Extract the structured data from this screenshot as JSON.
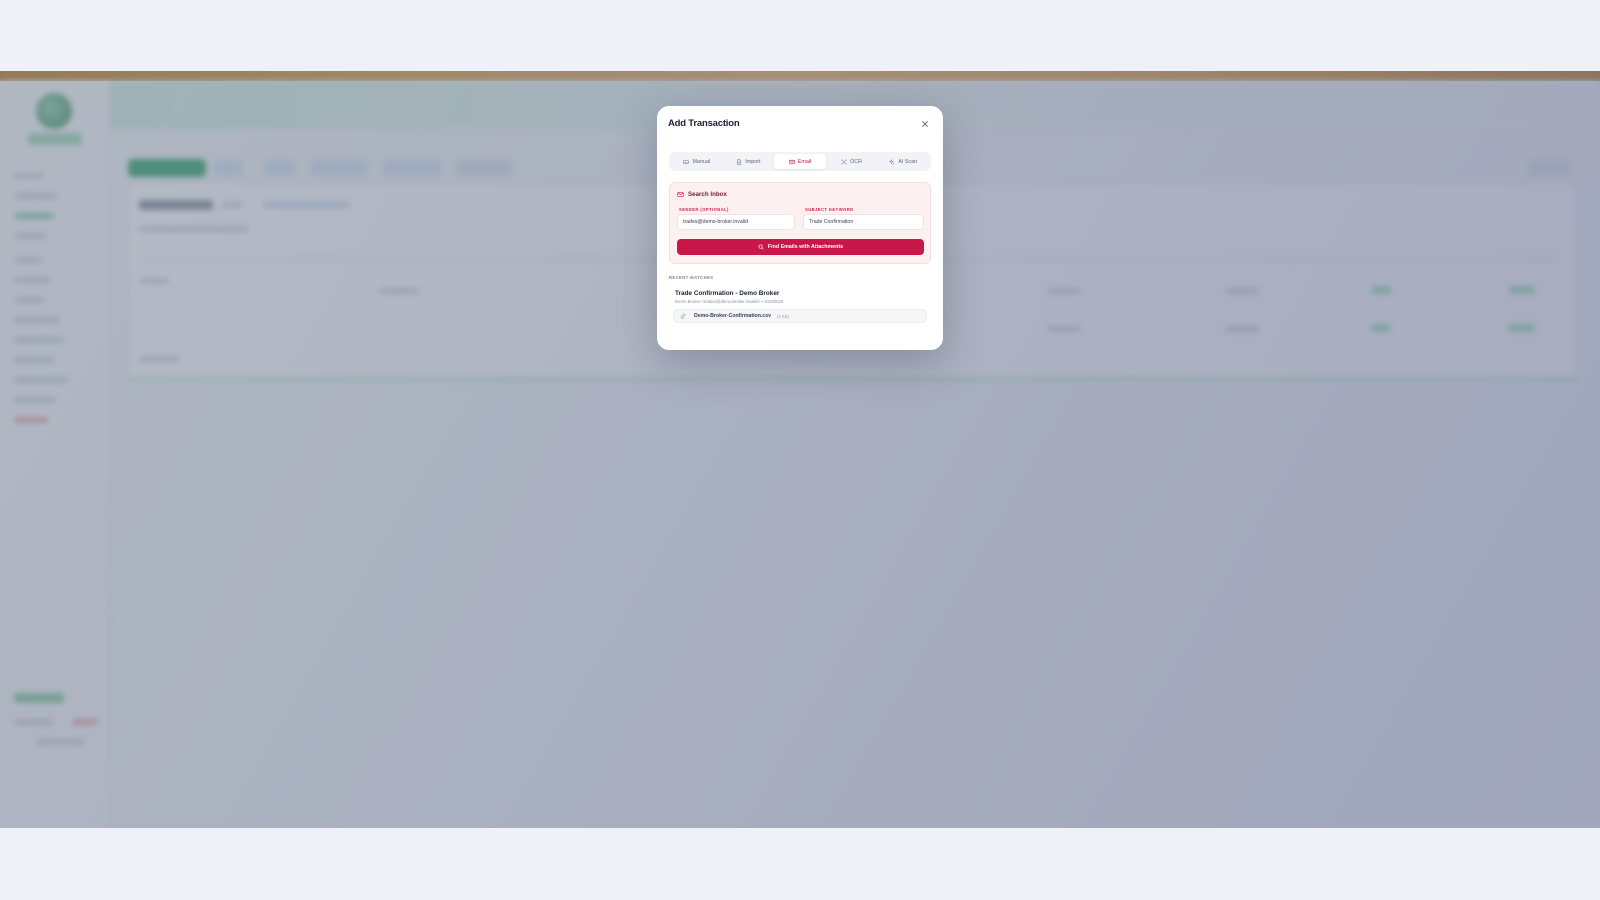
{
  "modal": {
    "title": "Add Transaction",
    "close_icon": "close-icon",
    "tabs": [
      {
        "label": "Manual",
        "icon": "keyboard-icon",
        "active": false
      },
      {
        "label": "Import",
        "icon": "document-icon",
        "active": false
      },
      {
        "label": "Email",
        "icon": "mail-icon",
        "active": true
      },
      {
        "label": "OCR",
        "icon": "scan-icon",
        "active": false
      },
      {
        "label": "AI Scan",
        "icon": "sparkle-icon",
        "active": false
      }
    ],
    "search": {
      "title": "Search Inbox",
      "sender_label": "SENDER (OPTIONAL)",
      "sender_value": "trades@demo-broker.invalid",
      "subject_label": "SUBJECT KEYWORD",
      "subject_value": "Trade Confirmation",
      "button_label": "Find Emails with Attachments"
    },
    "recent_matches_label": "RECENT MATCHES",
    "match": {
      "title": "Trade Confirmation - Demo Broker",
      "meta": "Demo Broker <trades@demo-broker.invalid> • 3/19/2026",
      "attachment_name": "Demo-Broker-Confirmation.csv",
      "attachment_size": "(4 KB)"
    }
  },
  "colors": {
    "accent": "#c8184a",
    "accent_bg": "#fdf0f1",
    "top_bar": "#d7912a",
    "brand_green": "#1e9e5a"
  }
}
